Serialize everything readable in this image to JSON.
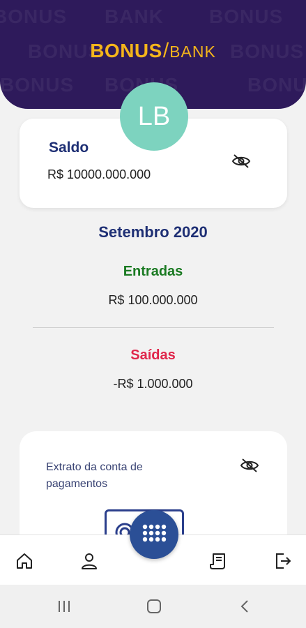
{
  "header": {
    "logo_bonus": "BONUS",
    "logo_slash": "/",
    "logo_bank": "BANK",
    "background_color": "#2e1a5b",
    "logo_color": "#f5b51b"
  },
  "user": {
    "initials": "LB",
    "avatar_color": "#7dd3bf"
  },
  "balance": {
    "label": "Saldo",
    "value": "R$ 10000.000.000",
    "visibility_icon": "eye-off-icon"
  },
  "summary": {
    "month": "Setembro 2020",
    "income_label": "Entradas",
    "income_value": "R$ 100.000.000",
    "income_color": "#1a7a22",
    "expense_label": "Saídas",
    "expense_value": "-R$ 1.000.000",
    "expense_color": "#e0264b"
  },
  "statement": {
    "text": "Extrato da conta de pagamentos",
    "visibility_icon": "eye-off-icon",
    "illustration_icon": "card-icon"
  },
  "bottom_nav": {
    "items": [
      {
        "icon": "home-icon"
      },
      {
        "icon": "user-icon"
      },
      {
        "icon": "keypad-icon"
      },
      {
        "icon": "receipt-icon"
      },
      {
        "icon": "logout-icon"
      }
    ],
    "fab_color": "#2b4f96"
  },
  "system_nav": {
    "items": [
      {
        "icon": "recents-icon"
      },
      {
        "icon": "home-circle-icon"
      },
      {
        "icon": "back-icon"
      }
    ]
  }
}
